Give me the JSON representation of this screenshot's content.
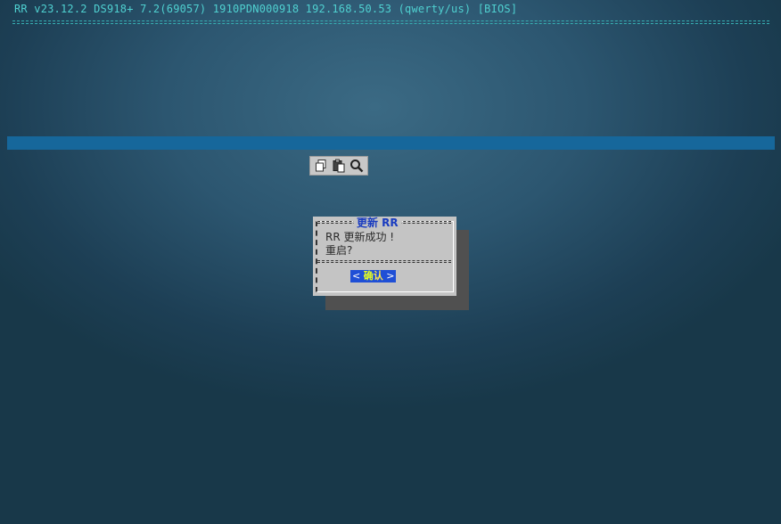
{
  "header": {
    "status_line": "RR v23.12.2 DS918+ 7.2(69057) 1910PDN000918 192.168.50.53 (qwerty/us) [BIOS]"
  },
  "toolbar": {
    "icons": [
      "copy-icon",
      "paste-icon",
      "search-icon"
    ]
  },
  "dialog": {
    "title": "更新 RR",
    "message_line1": "RR 更新成功 !",
    "message_line2": "重启?",
    "button": {
      "left_bracket": "< ",
      "hotkey": "确",
      "rest": "认",
      "right_bracket": " >"
    }
  },
  "colors": {
    "background": "#2c5670",
    "header_text": "#4fd0d0",
    "band": "#16679b",
    "dialog_bg": "#c4c4c4",
    "dialog_title": "#1a3cc0",
    "button_bg": "#1f4fd6",
    "button_hotkey": "#e6ff20"
  }
}
